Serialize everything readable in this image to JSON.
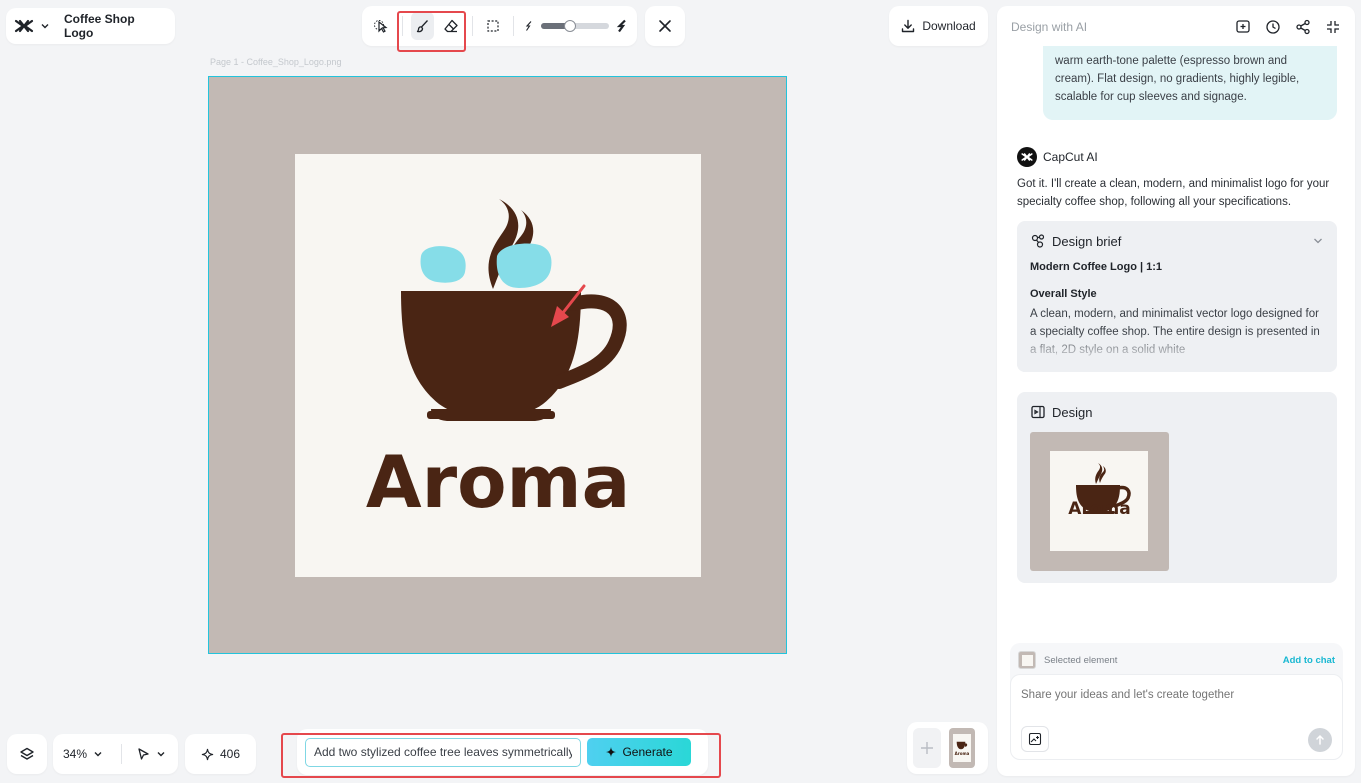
{
  "app": {
    "title": "Coffee Shop Logo"
  },
  "toolbar": {
    "tools": [
      "select-tool",
      "brush-tool",
      "eraser-tool",
      "marquee-tool"
    ],
    "active_tool": "brush-tool",
    "brush_size_fraction": 0.42
  },
  "header": {
    "download_label": "Download"
  },
  "canvas": {
    "page_label": "Page 1 -   Coffee_Shop_Logo.png",
    "logo_word": "Aroma"
  },
  "bottom": {
    "zoom": "34%",
    "credits": "406"
  },
  "generate": {
    "prompt_value": "Add two stylized coffee tree leaves symmetrically",
    "button_label": "Generate"
  },
  "panel": {
    "title": "Design with AI",
    "user_message": "warm earth-tone palette (espresso brown and cream). Flat design, no gradients, highly legible, scalable for cup sleeves and signage.",
    "ai_name": "CapCut AI",
    "ai_message": "Got it. I'll create a clean, modern, and minimalist logo for your specialty coffee shop, following all your specifications.",
    "brief": {
      "heading": "Design brief",
      "subtitle": "Modern Coffee Logo | 1:1",
      "section": "Overall Style",
      "body": "A clean, modern, and minimalist vector logo designed for a specialty coffee shop. The entire design is presented in a flat, 2D style on a solid white"
    },
    "design": {
      "heading": "Design",
      "thumb_word": "Aroma"
    },
    "chat": {
      "selected_label": "Selected element",
      "add_to_chat": "Add to chat",
      "placeholder": "Share your ideas and let's create together"
    }
  },
  "colors": {
    "accent": "#22c4dc",
    "coffee": "#4a2514",
    "mask": "#86dde8",
    "highlight": "#e5484d"
  }
}
